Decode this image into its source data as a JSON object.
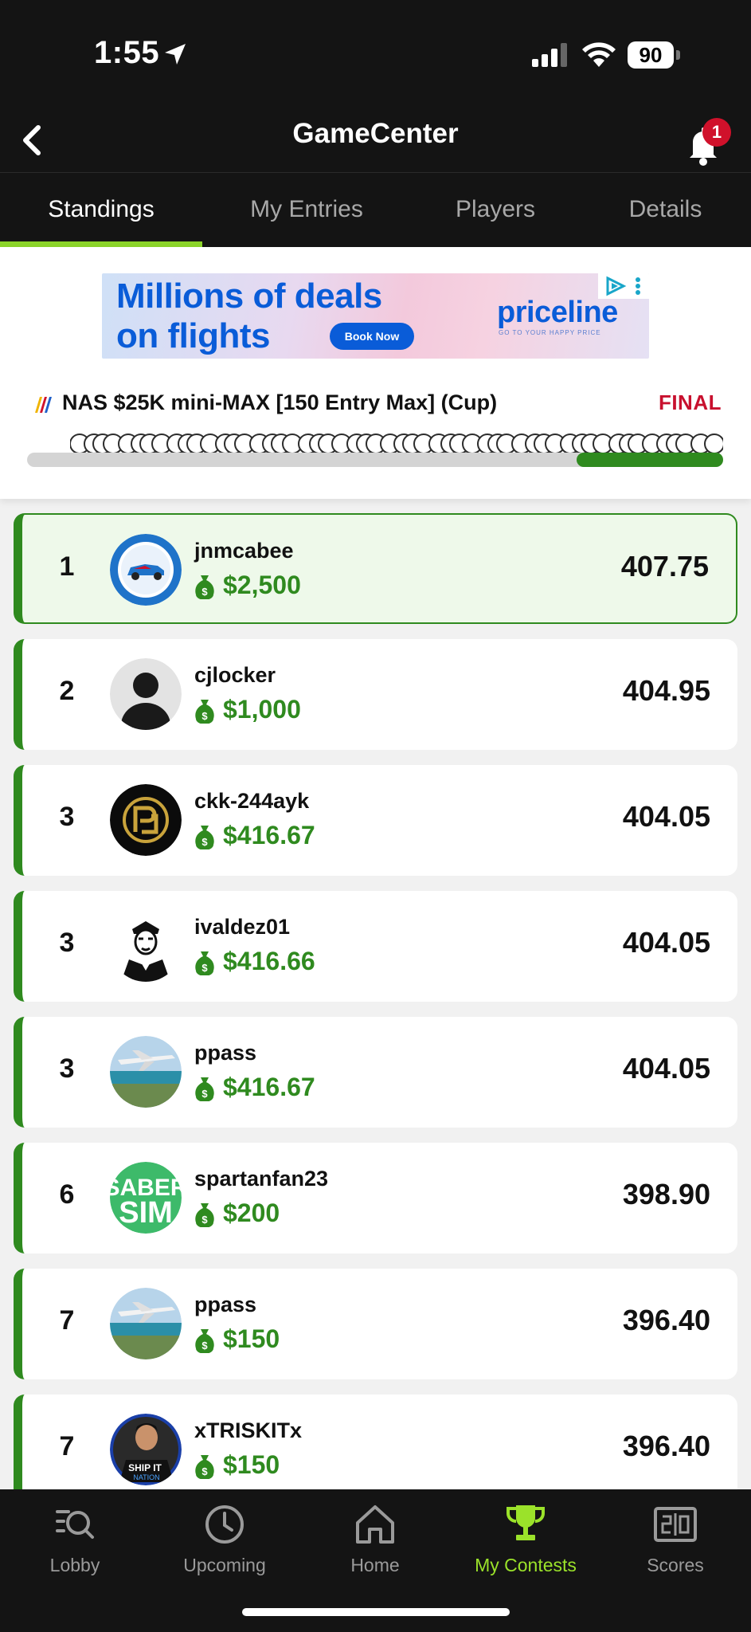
{
  "status_bar": {
    "time": "1:55",
    "battery": "90"
  },
  "header": {
    "title": "GameCenter",
    "notification_count": "1"
  },
  "tabs": [
    {
      "label": "Standings",
      "active": true
    },
    {
      "label": "My Entries",
      "active": false
    },
    {
      "label": "Players",
      "active": false
    },
    {
      "label": "Details",
      "active": false
    }
  ],
  "ad": {
    "headline_line1": "Millions of deals",
    "headline_line2": "on flights",
    "cta": "Book Now",
    "brand": "priceline",
    "tagline": "GO TO YOUR HAPPY PRICE"
  },
  "contest": {
    "name": "NAS $25K mini-MAX [150 Entry Max] (Cup)",
    "status": "FINAL",
    "progress_fraction": 0.21
  },
  "standings": [
    {
      "rank": "1",
      "username": "jnmcabee",
      "prize": "$2,500",
      "score": "407.75",
      "avatar": "race-car-avatar"
    },
    {
      "rank": "2",
      "username": "cjlocker",
      "prize": "$1,000",
      "score": "404.95",
      "avatar": "default-silhouette-avatar"
    },
    {
      "rank": "3",
      "username": "ckk-244ayk",
      "prize": "$416.67",
      "score": "404.05",
      "avatar": "gold-emblem-avatar"
    },
    {
      "rank": "3",
      "username": "ivaldez01",
      "prize": "$416.66",
      "score": "404.05",
      "avatar": "sailor-portrait-avatar"
    },
    {
      "rank": "3",
      "username": "ppass",
      "prize": "$416.67",
      "score": "404.05",
      "avatar": "airplane-photo-avatar"
    },
    {
      "rank": "6",
      "username": "spartanfan23",
      "prize": "$200",
      "score": "398.90",
      "avatar": "saber-sim-avatar"
    },
    {
      "rank": "7",
      "username": "ppass",
      "prize": "$150",
      "score": "396.40",
      "avatar": "airplane-photo-avatar"
    },
    {
      "rank": "7",
      "username": "xTRISKITx",
      "prize": "$150",
      "score": "396.40",
      "avatar": "ship-it-avatar"
    }
  ],
  "avatar_text": {
    "saber_line1": "SABER",
    "saber_line2": "SIM",
    "shipit_line1": "SHIP IT",
    "shipit_line2": "NATION"
  },
  "bottom_nav": [
    {
      "label": "Lobby",
      "icon": "lobby-search-icon",
      "active": false
    },
    {
      "label": "Upcoming",
      "icon": "clock-icon",
      "active": false
    },
    {
      "label": "Home",
      "icon": "home-icon",
      "active": false
    },
    {
      "label": "My Contests",
      "icon": "trophy-icon",
      "active": true
    },
    {
      "label": "Scores",
      "icon": "scoreboard-icon",
      "active": false
    }
  ],
  "colors": {
    "accent_green": "#2f8a1f",
    "nav_active": "#9be22a",
    "final_red": "#c8102e",
    "tab_underline": "#8bd42a"
  }
}
